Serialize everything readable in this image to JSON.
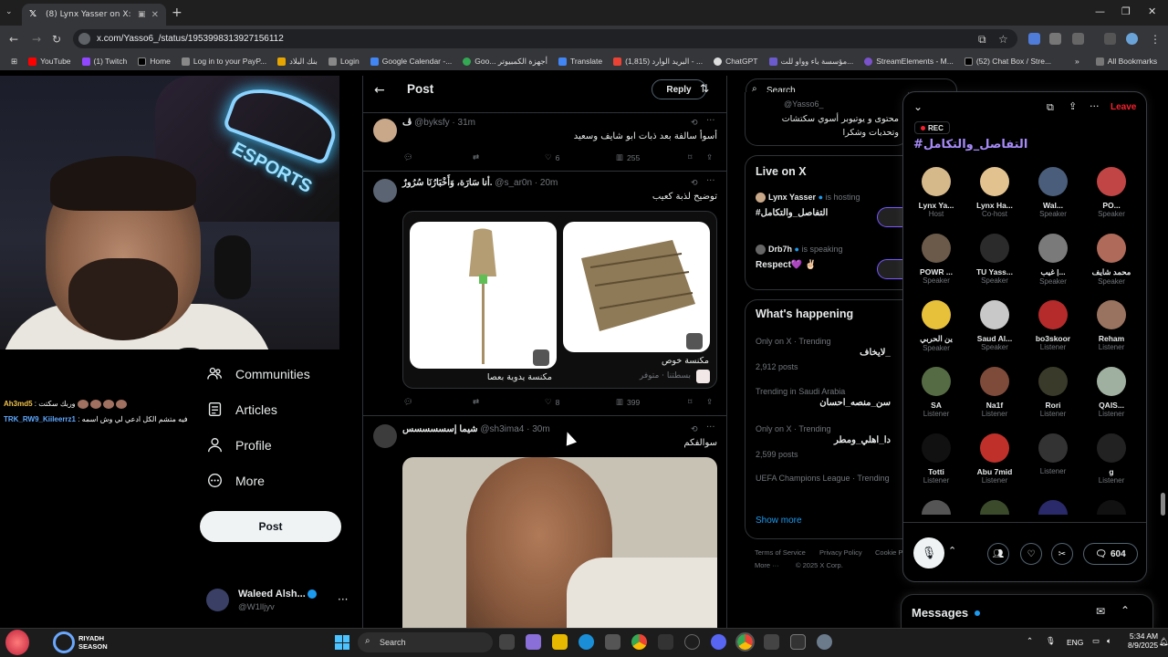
{
  "browser": {
    "tab_title": "(8) Lynx Yasser on X: \"https:",
    "url": "x.com/Yasso6_/status/1953998313927156112",
    "bookmarks": [
      "YouTube",
      "(1) Twitch",
      "Home",
      "Log in to your PayP...",
      "بنك البلاد",
      "Login",
      "Google Calendar -...",
      "Goo... أجهزة الكمبيوتر",
      "Translate",
      "(1,815) البريد الوارد - ...",
      "ChatGPT",
      "مؤسسة باء وواو للت...",
      "StreamElements - M...",
      "(52) Chat Box / Stre..."
    ],
    "all_bookmarks": "All Bookmarks"
  },
  "stream_chat": [
    {
      "user": "Ah3md5",
      "text": "وربك سكتت"
    },
    {
      "user": "TRK_RW9_Kiileerrz1",
      "text": "فيه متشم الكل ادعي لي وش اسمه"
    }
  ],
  "leftnav": {
    "items": [
      "Communities",
      "Articles",
      "Profile",
      "More"
    ],
    "post_button": "Post",
    "account_name": "Waleed Alsh...",
    "account_handle": "@W1lljyv"
  },
  "post_header": {
    "title": "Post",
    "reply_button": "Reply"
  },
  "tweets": [
    {
      "name": "ڤ",
      "handle": "@byksfy · 31m",
      "text": "أسوأ سالفة بعد ذبات ابو شايف وسعيد",
      "replies": "",
      "retweets": "",
      "likes": "6",
      "views": "255"
    },
    {
      "name": "أنا سَارَة، وَأَخْبَارُنَا سُرُورٌ.",
      "handle": "@s_ar0n · 20m",
      "text": "توضيح لذبة كعيب",
      "card_left_caption": "مكنسة يدوية بعصا",
      "card_right_caption": "مكنسة خوص",
      "card_right_seller": "بسطتنا · متوفر",
      "likes": "8",
      "views": "399"
    },
    {
      "name": "شيما إسسسسسس",
      "handle": "@sh3ima4 · 30m",
      "text": "سوالفكم"
    }
  ],
  "search": {
    "placeholder": "Search"
  },
  "top_card_text": [
    "@Yasso6_",
    "محتوى و يوتيوبر أسوي سكتشات",
    "وتحديات وشكرا"
  ],
  "live": {
    "title": "Live on X",
    "items": [
      {
        "host": "Lynx Yasser",
        "status": "is hosting",
        "title": "#التفاصل_والتكامل"
      },
      {
        "host": "Drb7h",
        "status": "is speaking",
        "title": "Respect💜 ✌🏻"
      }
    ]
  },
  "happening": {
    "title": "What's happening",
    "items": [
      {
        "context": "Only on X · Trending",
        "topic": "_لايخاف",
        "count": "2,912 posts"
      },
      {
        "context": "Trending in Saudi Arabia",
        "topic": "سن_منصه_احسان",
        "count": ""
      },
      {
        "context": "Only on X · Trending",
        "topic": "دا_اهلي_ومطر",
        "count": "2,599 posts"
      },
      {
        "context": "UEFA Champions League · Trending",
        "topic": "",
        "count": ""
      }
    ],
    "show_more": "Show more"
  },
  "footer_links": [
    "Terms of Service",
    "Privacy Policy",
    "Cookie P...",
    "More ···",
    "© 2025 X Corp."
  ],
  "spaces": {
    "rec": "REC",
    "leave": "Leave",
    "title": "#التفاصل_والتكامل",
    "participants": [
      {
        "name": "Lynx Ya...",
        "role": "Host"
      },
      {
        "name": "Lynx Ha...",
        "role": "Co-host"
      },
      {
        "name": "Wal...",
        "role": "Speaker"
      },
      {
        "name": "PO...",
        "role": "Speaker"
      },
      {
        "name": "POWR ...",
        "role": "Speaker"
      },
      {
        "name": "TU Yass...",
        "role": "Speaker"
      },
      {
        "name": "غيب |...",
        "role": "Speaker"
      },
      {
        "name": "محمد شايف",
        "role": "Speaker"
      },
      {
        "name": "ين الحربي",
        "role": "Speaker"
      },
      {
        "name": "Saud Al...",
        "role": "Speaker"
      },
      {
        "name": "bo3skoor",
        "role": "Listener"
      },
      {
        "name": "Reham",
        "role": "Listener"
      },
      {
        "name": "SA",
        "role": "Listener"
      },
      {
        "name": "Na1f",
        "role": "Listener"
      },
      {
        "name": "Rori",
        "role": "Listener"
      },
      {
        "name": "QAIS...",
        "role": "Listener"
      },
      {
        "name": "Totti",
        "role": "Listener"
      },
      {
        "name": "Abu 7mid",
        "role": "Listener"
      },
      {
        "name": "",
        "role": "Listener"
      },
      {
        "name": "g",
        "role": "Listener"
      }
    ],
    "reply_count": "604"
  },
  "messages": {
    "title": "Messages"
  },
  "taskbar": {
    "search": "Search",
    "lang": "ENG",
    "time": "5:34 AM",
    "date": "8/9/2025",
    "riyadh": "RIYADH SEASON"
  }
}
